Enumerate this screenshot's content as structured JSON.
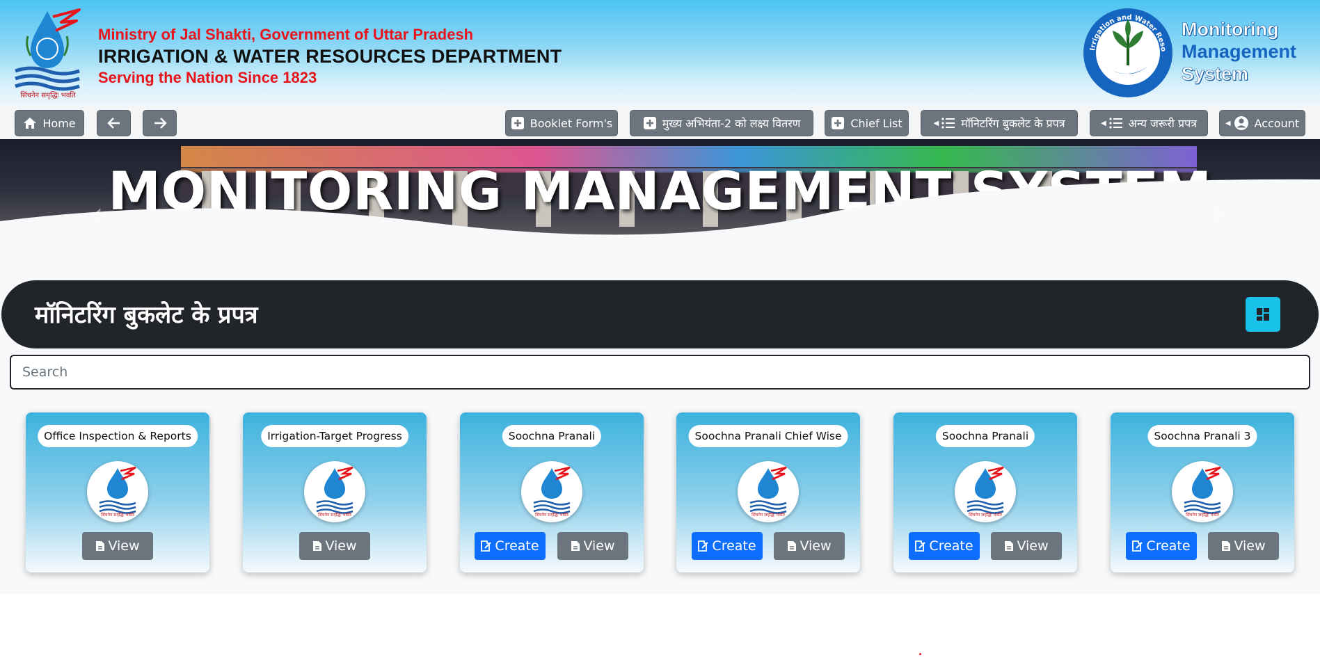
{
  "header": {
    "ministry": "Ministry of Jal Shakti, Government of Uttar Pradesh",
    "department": "IRRIGATION & WATER RESOURCES DEPARTMENT",
    "since": "Serving the Nation Since 1823",
    "logo_caption": "सिंचनेन समृद्धिः भवति",
    "seal_text": "Irrigation and Water Resources Department, UP",
    "app_name_line1": "Monitoring",
    "app_name_line2": "Management",
    "app_name_line3": "System"
  },
  "nav": {
    "home": "Home",
    "booklet_forms": "Booklet Form's",
    "target_distribution": "मुख्य अभियंता-2 को लक्ष्य वितरण",
    "chief_list": "Chief List",
    "monitoring_booklet": "मॉनिटरिंग बुकलेट के प्रपत्र",
    "other_forms": "अन्य जरूरी प्रपत्र",
    "account": "Account"
  },
  "banner": {
    "title": "MONITORING MANAGEMENT SYSTEM"
  },
  "section": {
    "title": "मॉनिटरिंग बुकलेट के प्रपत्र"
  },
  "search": {
    "placeholder": "Search",
    "value": ""
  },
  "cards": [
    {
      "title": "Office Inspection & Reports",
      "view": "View"
    },
    {
      "title": "Irrigation-Target Progress",
      "view": "View"
    },
    {
      "title": "Soochna Pranali",
      "create": "Create",
      "view": "View"
    },
    {
      "title": "Soochna Pranali Chief Wise",
      "create": "Create",
      "view": "View"
    },
    {
      "title": "Soochna Pranali",
      "create": "Create",
      "view": "View"
    },
    {
      "title": "Soochna Pranali 3",
      "create": "Create",
      "view": "View"
    }
  ],
  "colors": {
    "accent_red": "#e8141b",
    "nav_button": "#6c757d",
    "create_button": "#0d6efd",
    "section_bar": "#212529",
    "grid_button": "#17c1e8"
  }
}
